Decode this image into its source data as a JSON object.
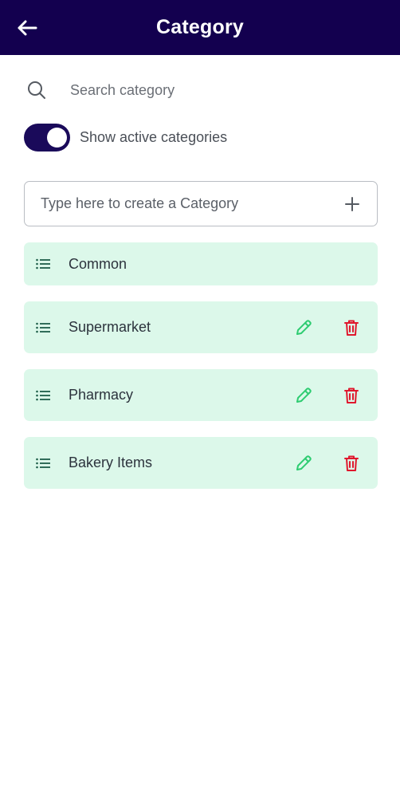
{
  "header": {
    "title": "Category",
    "back_icon": "arrow-left-icon"
  },
  "search": {
    "placeholder": "Search category",
    "icon": "search-icon"
  },
  "toggle": {
    "label": "Show active categories",
    "on": true
  },
  "create": {
    "placeholder": "Type here to create a Category",
    "add_icon": "plus-icon"
  },
  "categories": [
    {
      "name": "Common",
      "editable": false
    },
    {
      "name": "Supermarket",
      "editable": true
    },
    {
      "name": "Pharmacy",
      "editable": true
    },
    {
      "name": "Bakery Items",
      "editable": true
    }
  ],
  "colors": {
    "appbar": "#13004f",
    "toggle": "#1a0a5a",
    "item_bg": "#dcf8ea",
    "edit": "#2ecc71",
    "delete": "#e0182d",
    "list_icon": "#1f5e4a"
  }
}
